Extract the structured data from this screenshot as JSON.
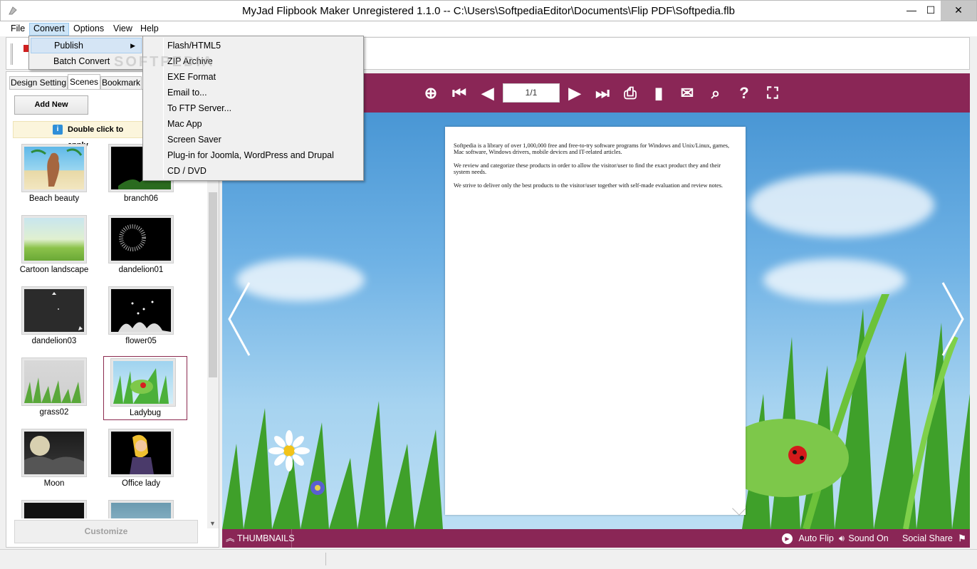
{
  "window": {
    "title": "MyJad Flipbook Maker Unregistered 1.1.0  -- C:\\Users\\SoftpediaEditor\\Documents\\Flip PDF\\Softpedia.flb",
    "minimize": "—",
    "maximize": "☐",
    "close": "✕"
  },
  "menubar": {
    "items": [
      {
        "label": "File"
      },
      {
        "label": "Convert"
      },
      {
        "label": "Options"
      },
      {
        "label": "View"
      },
      {
        "label": "Help"
      }
    ]
  },
  "convert_menu": {
    "items": [
      {
        "label": "Publish",
        "submenu_arrow": "▶"
      },
      {
        "label": "Batch Convert"
      }
    ]
  },
  "publish_submenu": {
    "items": [
      {
        "label": "Flash/HTML5"
      },
      {
        "label": "ZIP Archive"
      },
      {
        "label": "EXE Format"
      },
      {
        "label": "Email to..."
      },
      {
        "label": "To FTP Server..."
      },
      {
        "label": "Mac App"
      },
      {
        "label": "Screen Saver"
      },
      {
        "label": "Plug-in for Joomla, WordPress and Drupal"
      },
      {
        "label": "CD / DVD"
      }
    ]
  },
  "watermark": "SOFTPEDIA",
  "left_panel": {
    "tabs": [
      {
        "label": "Design Setting"
      },
      {
        "label": "Scenes"
      },
      {
        "label": "Bookmark"
      }
    ],
    "add_new": "Add New",
    "hint": "Double click to apply",
    "hint_icon": "i",
    "scenes": [
      {
        "name": "Beach beauty"
      },
      {
        "name": "branch06"
      },
      {
        "name": "Cartoon landscape"
      },
      {
        "name": "dandelion01"
      },
      {
        "name": "dandelion03"
      },
      {
        "name": "flower05"
      },
      {
        "name": "grass02"
      },
      {
        "name": "Ladybug"
      },
      {
        "name": "Moon"
      },
      {
        "name": "Office lady"
      },
      {
        "name": ""
      },
      {
        "name": ""
      }
    ],
    "selected_scene": "Ladybug",
    "customize": "Customize",
    "scroll_down": "▼"
  },
  "viewer": {
    "page_indicator": "1/1",
    "page_paragraphs": [
      "Softpedia is a library of over 1,000,000 free and free-to-try software programs for Windows and Unix/Linux, games, Mac software, Windows drivers, mobile devices and IT-related articles.",
      "We review and categorize these products in order to allow the visitor/user to find the exact product they and their system needs.",
      "We strive to deliver only the best products to the visitor/user together with self-made evaluation and review notes."
    ],
    "bottom": {
      "thumbnails": "THUMBNAILS",
      "auto_flip": "Auto Flip",
      "sound_on": "Sound On",
      "social_share": "Social Share"
    },
    "colors": {
      "bar": "#8a2656",
      "sky": "#6fb2e5"
    },
    "icons": [
      "zoom-in-icon",
      "first-page-icon",
      "prev-page-icon",
      "next-page-icon",
      "last-page-icon",
      "print-icon",
      "bookmark-icon",
      "email-icon",
      "search-icon",
      "help-icon",
      "fullscreen-icon"
    ]
  }
}
